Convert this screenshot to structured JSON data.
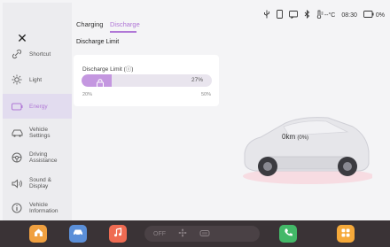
{
  "sidebar": {
    "items": [
      {
        "label": "Shortcut",
        "icon": "link-icon"
      },
      {
        "label": "Light",
        "icon": "sun-icon"
      },
      {
        "label": "Energy",
        "icon": "battery-icon",
        "active": true
      },
      {
        "label": "Vehicle\nSettings",
        "icon": "car-icon"
      },
      {
        "label": "Driving\nAssistance",
        "icon": "steering-wheel-icon"
      },
      {
        "label": "Sound &\nDisplay",
        "icon": "speaker-icon"
      },
      {
        "label": "Vehicle\nInformation",
        "icon": "info-icon"
      }
    ]
  },
  "tabs": [
    {
      "label": "Charging"
    },
    {
      "label": "Discharge",
      "active": true
    }
  ],
  "status": {
    "temperature": "--°C",
    "time": "08:30",
    "battery": "0%"
  },
  "discharge": {
    "section_title": "Discharge Limit",
    "card_label": "Discharge Limit (ⓘ)",
    "value_label": "27%",
    "level": 0.23,
    "range_min": "20%",
    "range_max": "50%"
  },
  "car": {
    "range": "0km",
    "percent": "(0%)"
  },
  "dock": {
    "climate_label": "OFF"
  },
  "colors": {
    "accent": "#b077d6",
    "home": "#f0a040",
    "car_app": "#5b8fd8",
    "music": "#ef6b52",
    "phone": "#43b868",
    "apps": "#f5a93a"
  }
}
